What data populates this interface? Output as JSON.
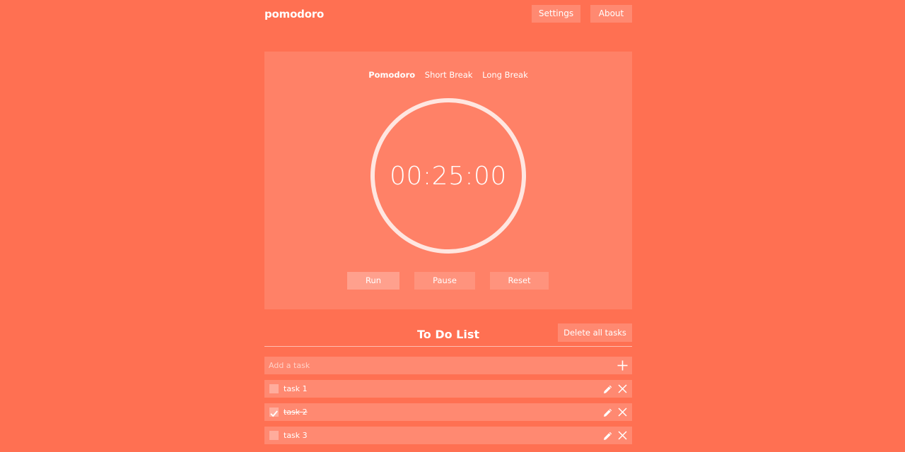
{
  "header": {
    "brand": "pomodoro",
    "settings_label": "Settings",
    "about_label": "About"
  },
  "timer": {
    "modes": [
      "Pomodoro",
      "Short Break",
      "Long Break"
    ],
    "active_mode": "Pomodoro",
    "time": "00:25:00",
    "run_label": "Run",
    "pause_label": "Pause",
    "reset_label": "Reset"
  },
  "todo": {
    "title": "To Do List",
    "delete_all_label": "Delete all tasks",
    "add_placeholder": "Add a task",
    "tasks": [
      {
        "label": "task 1",
        "done": false
      },
      {
        "label": "task 2",
        "done": true
      },
      {
        "label": "task 3",
        "done": false
      }
    ]
  },
  "icons": {
    "add": "plus-icon",
    "edit": "pencil-icon",
    "delete": "close-icon",
    "check": "checkmark-icon"
  },
  "colors": {
    "background": "#ff7052",
    "foreground": "#ffffff"
  }
}
